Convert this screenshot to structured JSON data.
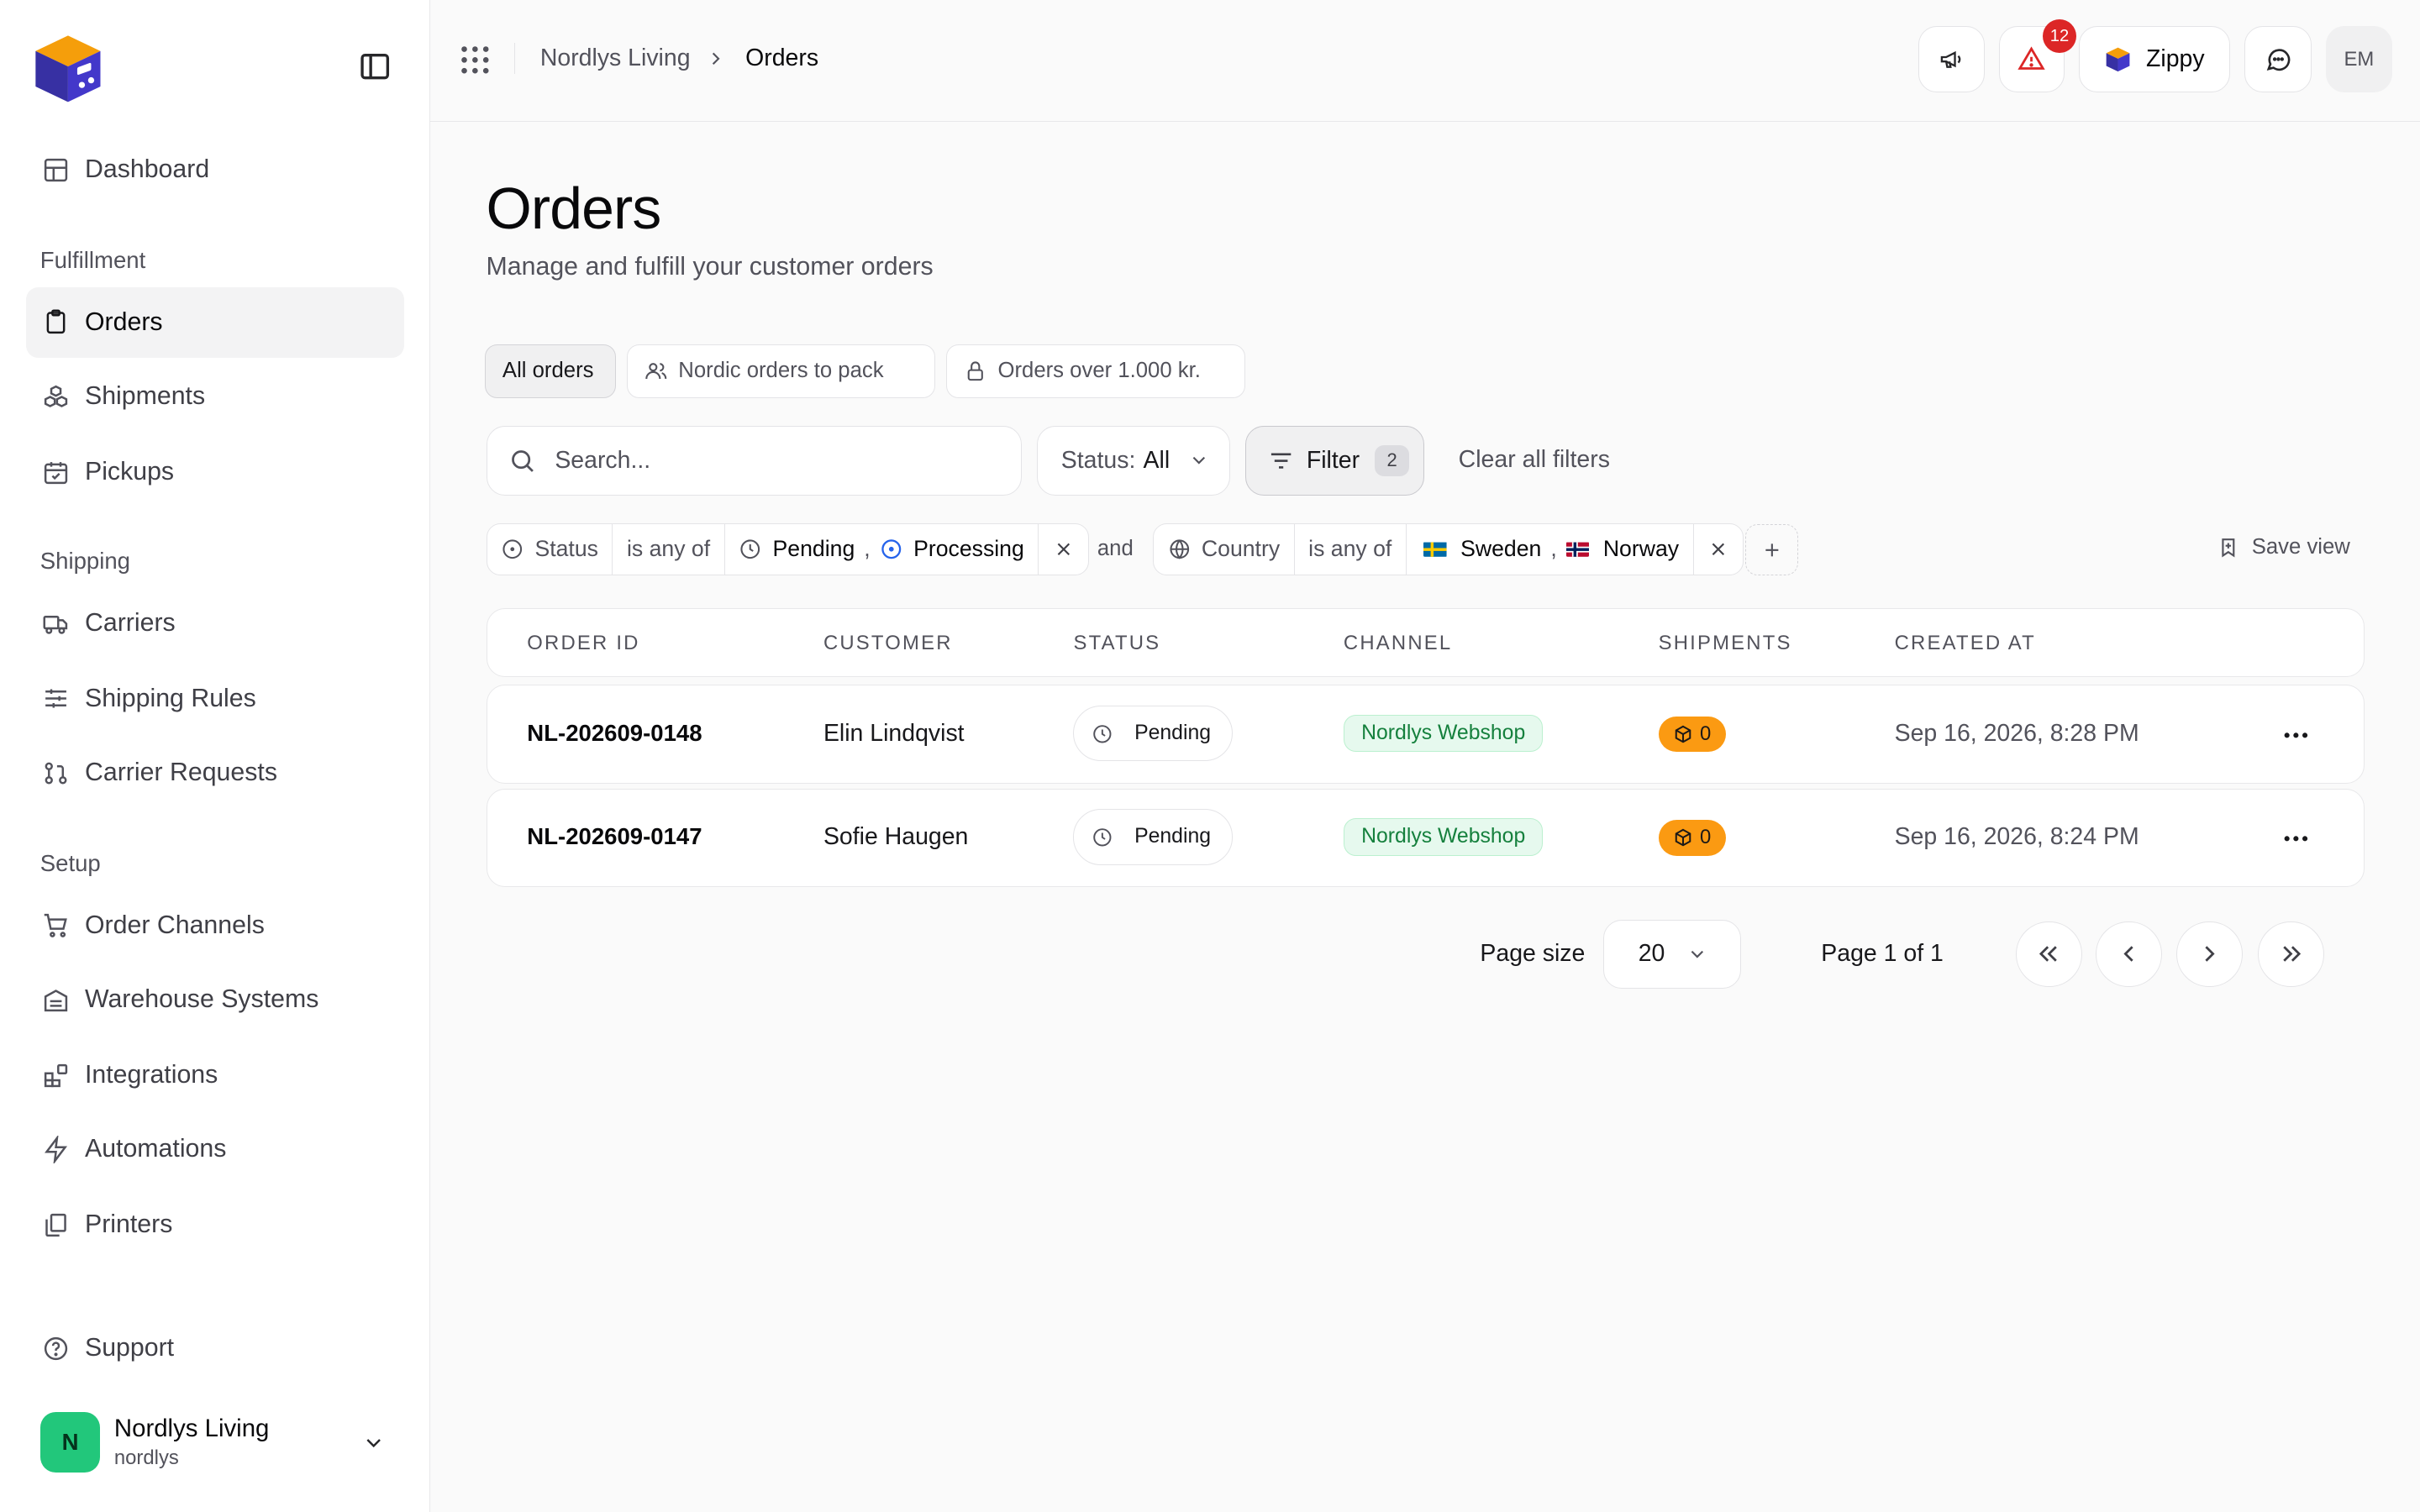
{
  "sidebar": {
    "dashboard": "Dashboard",
    "sections": {
      "fulfillment": "Fulfillment",
      "shipping": "Shipping",
      "setup": "Setup"
    },
    "items": {
      "orders": "Orders",
      "shipments": "Shipments",
      "pickups": "Pickups",
      "carriers": "Carriers",
      "shipping_rules": "Shipping Rules",
      "carrier_requests": "Carrier Requests",
      "order_channels": "Order Channels",
      "warehouse_systems": "Warehouse Systems",
      "integrations": "Integrations",
      "automations": "Automations",
      "printers": "Printers"
    },
    "support": "Support",
    "account": {
      "initial": "N",
      "name": "Nordlys Living",
      "handle": "nordlys"
    }
  },
  "topbar": {
    "breadcrumb": {
      "workspace": "Nordlys Living",
      "current": "Orders"
    },
    "alerts_count": "12",
    "zippy_label": "Zippy",
    "user_initials": "EM"
  },
  "page": {
    "title": "Orders",
    "subtitle": "Manage and fulfill your customer orders"
  },
  "views": {
    "all": "All orders",
    "nordic": "Nordic orders to pack",
    "over": "Orders over 1.000 kr."
  },
  "toolbar": {
    "search_placeholder": "Search...",
    "status_label": "Status:",
    "status_value": "All",
    "filter_label": "Filter",
    "filter_count": "2",
    "clear_all": "Clear all filters"
  },
  "filters": {
    "status": {
      "field": "Status",
      "op": "is any of",
      "values": [
        "Pending",
        "Processing"
      ]
    },
    "joiner": "and",
    "country": {
      "field": "Country",
      "op": "is any of",
      "values": [
        "Sweden",
        "Norway"
      ]
    },
    "save_view": "Save view"
  },
  "table": {
    "headers": [
      "ORDER ID",
      "CUSTOMER",
      "STATUS",
      "CHANNEL",
      "SHIPMENTS",
      "CREATED AT"
    ],
    "rows": [
      {
        "order_id": "NL-202609-0148",
        "customer": "Elin Lindqvist",
        "status": "Pending",
        "channel": "Nordlys Webshop",
        "shipments": "0",
        "created_at": "Sep 16, 2026, 8:28 PM"
      },
      {
        "order_id": "NL-202609-0147",
        "customer": "Sofie Haugen",
        "status": "Pending",
        "channel": "Nordlys Webshop",
        "shipments": "0",
        "created_at": "Sep 16, 2026, 8:24 PM"
      }
    ]
  },
  "pagination": {
    "page_size_label": "Page size",
    "page_size": "20",
    "page_info": "Page 1 of 1"
  },
  "colors": {
    "active_nav_bg": "#f3f3f4",
    "alert_badge": "#dc2626",
    "channel_green": "#15803d",
    "shipments_orange": "#fb9a12",
    "avatar_green": "#22c77b"
  }
}
